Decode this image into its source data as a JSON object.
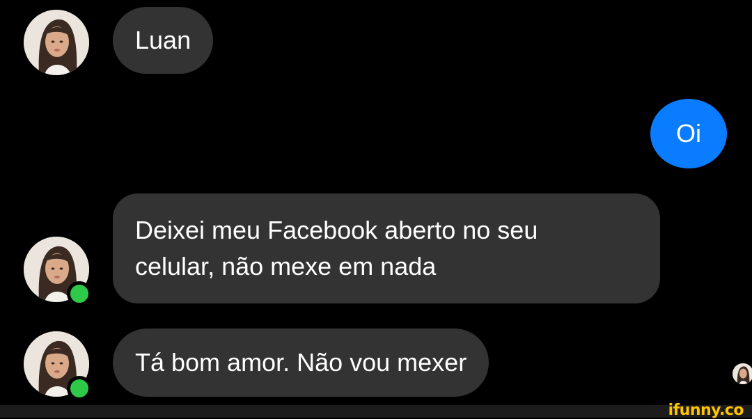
{
  "conversation": {
    "messages": [
      {
        "sender": "contact",
        "text": "Luan"
      },
      {
        "sender": "me",
        "text": "Oi"
      },
      {
        "sender": "contact",
        "text": "Deixei meu Facebook aberto no seu celular, não mexe em nada"
      },
      {
        "sender": "contact",
        "text": "Tá bom amor. Não vou mexer"
      }
    ],
    "contact_online": true
  },
  "watermark": "ifunny.co",
  "colors": {
    "background": "#000000",
    "incoming_bubble": "#333333",
    "outgoing_bubble": "#0a7cff",
    "online_indicator": "#2fc94a",
    "watermark": "#ffc300"
  },
  "icons": [
    "contact-avatar-icon",
    "online-status-icon",
    "read-receipt-avatar-icon"
  ]
}
